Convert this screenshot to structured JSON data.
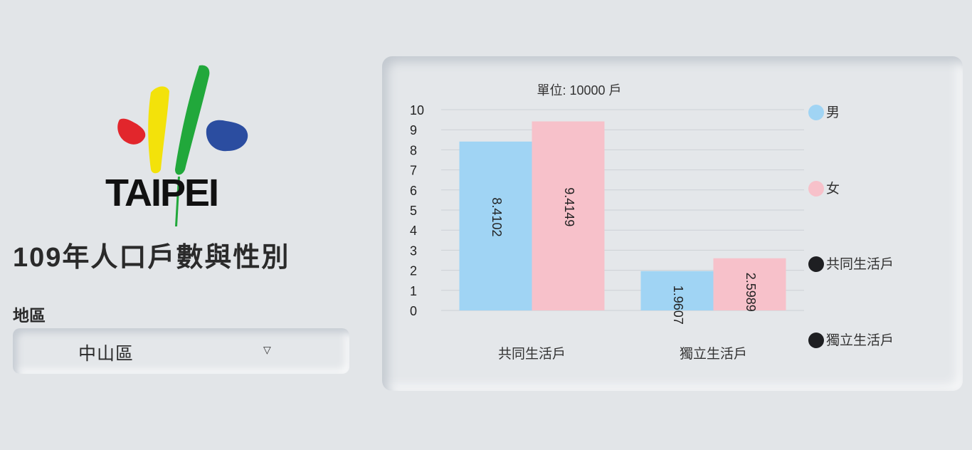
{
  "logo": {
    "text": "TAIPEI"
  },
  "page_title": "109年人口戶數與性別",
  "district": {
    "label": "地區",
    "selected": "中山區"
  },
  "chart_data": {
    "type": "bar",
    "title": "單位: 10000 戶",
    "categories": [
      "共同生活戶",
      "獨立生活戶"
    ],
    "series": [
      {
        "name": "男",
        "values": [
          8.4102,
          1.9607
        ],
        "color": "#a0d4f4"
      },
      {
        "name": "女",
        "values": [
          9.4149,
          2.5989
        ],
        "color": "#f7c1ca"
      }
    ],
    "extra_legend": [
      {
        "name": "共同生活戶",
        "color": "#1e1f22"
      },
      {
        "name": "獨立生活戶",
        "color": "#1e1f22"
      }
    ],
    "ylim": [
      0,
      10
    ],
    "yticks": [
      "0",
      "1",
      "2",
      "3",
      "4",
      "5",
      "6",
      "7",
      "8",
      "9",
      "10"
    ],
    "grid": true,
    "legend_position": "right"
  }
}
